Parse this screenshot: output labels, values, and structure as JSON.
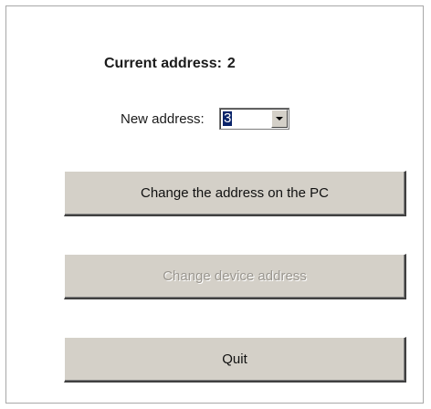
{
  "current_address": {
    "label": "Current address:",
    "value": "2"
  },
  "new_address": {
    "label": "New address:",
    "selected": "3"
  },
  "buttons": {
    "change_pc": "Change the address on the PC",
    "change_device": "Change device address",
    "quit": "Quit"
  },
  "states": {
    "change_device_enabled": false
  },
  "icons": {
    "dropdown": "chevron-down-icon"
  }
}
